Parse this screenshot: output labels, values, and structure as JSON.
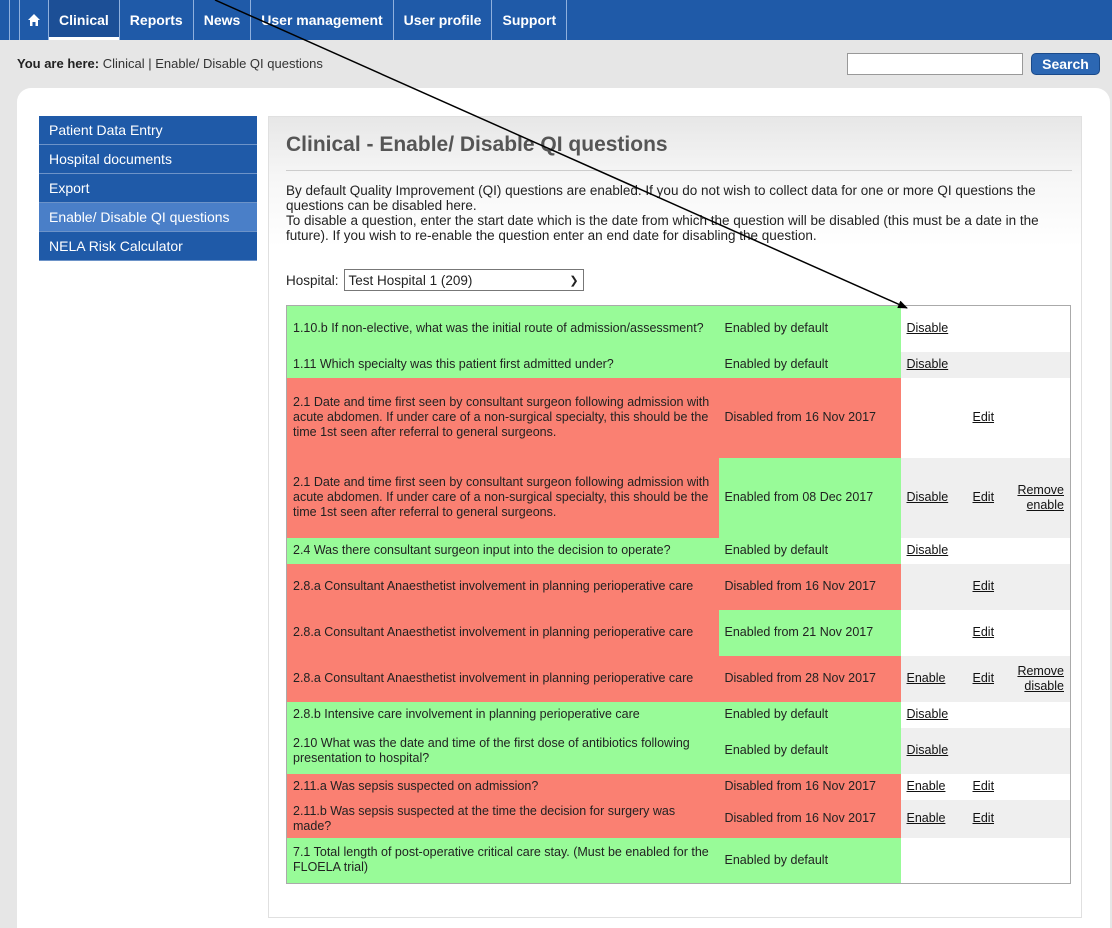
{
  "nav": {
    "home_icon": "home-icon",
    "items": [
      "Clinical",
      "Reports",
      "News",
      "User management",
      "User profile",
      "Support"
    ]
  },
  "breadcrumb": {
    "prefix": "You are here:",
    "path": "Clinical | Enable/ Disable QI questions"
  },
  "search": {
    "value": "",
    "button_label": "Search"
  },
  "sidebar": {
    "items": [
      {
        "label": "Patient Data Entry"
      },
      {
        "label": "Hospital documents"
      },
      {
        "label": "Export"
      },
      {
        "label": "Enable/ Disable QI questions",
        "active": true
      },
      {
        "label": "NELA Risk Calculator"
      }
    ]
  },
  "page": {
    "title": "Clinical - Enable/ Disable QI questions",
    "intro_line1": "By default Quality Improvement (QI) questions are enabled. If you do not wish to collect data for one or more QI questions the questions can be disabled here.",
    "intro_line2": "To disable a question, enter the start date which is the date from which the question will be disabled (this must be a date in the future). If you wish to re-enable the question enter an end date for disabling the question.",
    "hospital_label": "Hospital:",
    "hospital_value": "Test Hospital 1 (209)"
  },
  "rows": [
    {
      "q": "1.10.b If non-elective, what was the initial route of admission/assessment?",
      "qc": "green",
      "s": "Enabled by default",
      "sc": "green",
      "a": "Disable",
      "e": "",
      "r": ""
    },
    {
      "q": "1.11 Which specialty was this patient first admitted under?",
      "qc": "green",
      "s": "Enabled by default",
      "sc": "green",
      "a": "Disable",
      "e": "",
      "r": ""
    },
    {
      "q": "2.1 Date and time first seen by consultant surgeon following admission with acute abdomen. If under care of a non-surgical specialty, this should be the time 1st seen after referral to general surgeons.",
      "qc": "red",
      "s": "Disabled from 16 Nov 2017",
      "sc": "red",
      "a": "",
      "e": "Edit",
      "r": ""
    },
    {
      "q": "2.1 Date and time first seen by consultant surgeon following admission with acute abdomen. If under care of a non-surgical specialty, this should be the time 1st seen after referral to general surgeons.",
      "qc": "red",
      "s": "Enabled from 08 Dec 2017",
      "sc": "green",
      "a": "Disable",
      "e": "Edit",
      "r": "Remove enable"
    },
    {
      "q": "2.4 Was there consultant surgeon input into the decision to operate?",
      "qc": "green",
      "s": "Enabled by default",
      "sc": "green",
      "a": "Disable",
      "e": "",
      "r": ""
    },
    {
      "q": "2.8.a Consultant Anaesthetist involvement in planning perioperative care",
      "qc": "red",
      "s": "Disabled from 16 Nov 2017",
      "sc": "red",
      "a": "",
      "e": "Edit",
      "r": ""
    },
    {
      "q": "2.8.a Consultant Anaesthetist involvement in planning perioperative care",
      "qc": "red",
      "s": "Enabled from 21 Nov 2017",
      "sc": "green",
      "a": "",
      "e": "Edit",
      "r": ""
    },
    {
      "q": "2.8.a Consultant Anaesthetist involvement in planning perioperative care",
      "qc": "red",
      "s": "Disabled from 28 Nov 2017",
      "sc": "red",
      "a": "Enable",
      "e": "Edit",
      "r": "Remove disable"
    },
    {
      "q": "2.8.b Intensive care involvement in planning perioperative care",
      "qc": "green",
      "s": "Enabled by default",
      "sc": "green",
      "a": "Disable",
      "e": "",
      "r": ""
    },
    {
      "q": "2.10 What was the date and time of the first dose of antibiotics following presentation to hospital?",
      "qc": "green",
      "s": "Enabled by default",
      "sc": "green",
      "a": "Disable",
      "e": "",
      "r": ""
    },
    {
      "q": "2.11.a Was sepsis suspected on admission?",
      "qc": "red",
      "s": "Disabled from 16 Nov 2017",
      "sc": "red",
      "a": "Enable",
      "e": "Edit",
      "r": ""
    },
    {
      "q": "2.11.b Was sepsis suspected at the time the decision for surgery was made?",
      "qc": "red",
      "s": "Disabled from 16 Nov 2017",
      "sc": "red",
      "a": "Enable",
      "e": "Edit",
      "r": ""
    },
    {
      "q": "7.1 Total length of post-operative critical care stay. (Must be enabled for the FLOELA trial)",
      "qc": "green",
      "s": "Enabled by default",
      "sc": "green",
      "a": "",
      "e": "",
      "r": ""
    }
  ]
}
